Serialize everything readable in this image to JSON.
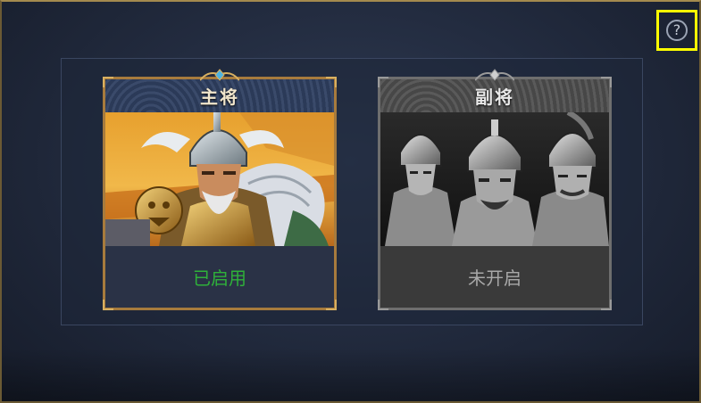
{
  "help": {
    "icon": "question-icon",
    "glyph": "?"
  },
  "cards": {
    "main": {
      "title": "主将",
      "status": "已启用",
      "status_color": "#2fb13a"
    },
    "sub": {
      "title": "副将",
      "status": "未开启",
      "status_color": "#a8a8a8"
    }
  },
  "colors": {
    "main_frame": "#a77b3d",
    "sub_frame": "#6e6e6e",
    "highlight": "#ffff00"
  }
}
